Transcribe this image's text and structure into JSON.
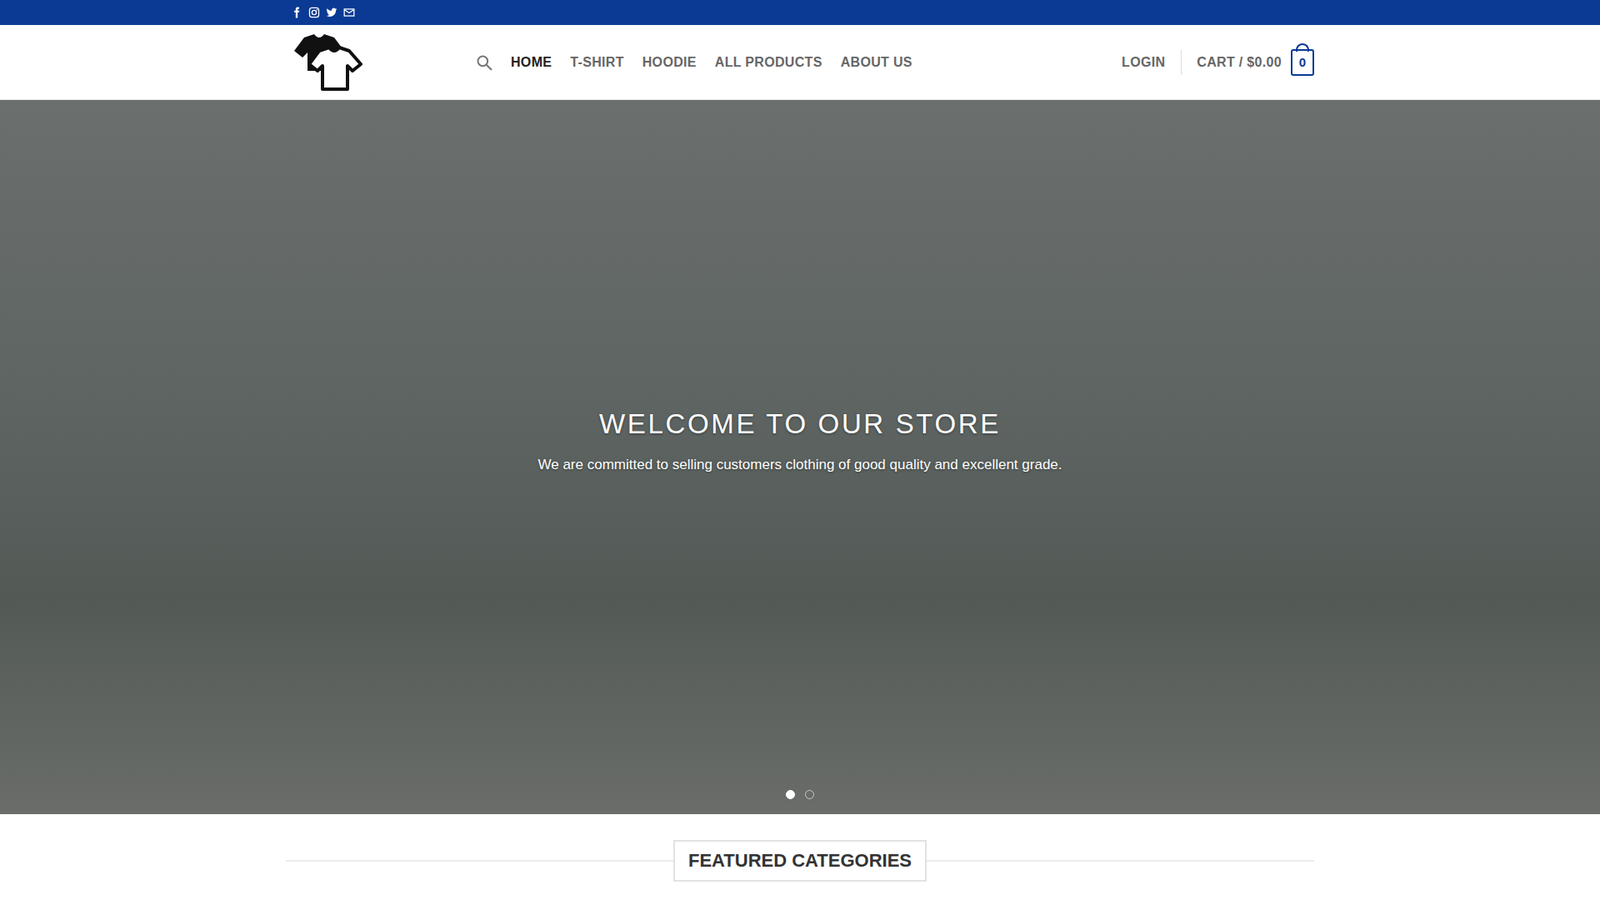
{
  "nav": [
    {
      "label": "HOME",
      "selected": true
    },
    {
      "label": "T-SHIRT",
      "selected": false
    },
    {
      "label": "HOODIE",
      "selected": false
    },
    {
      "label": "ALL PRODUCTS",
      "selected": false
    },
    {
      "label": "ABOUT US",
      "selected": false
    }
  ],
  "login": "LOGIN",
  "cart": {
    "label": "CART / $0.00",
    "count": "0"
  },
  "hero": {
    "title": "WELCOME TO OUR STORE",
    "subtitle": "We are committed to selling customers clothing of good quality and excellent grade.",
    "slides": [
      {
        "selected": true
      },
      {
        "selected": false
      }
    ]
  },
  "featured": {
    "title": "FEATURED CATEGORIES"
  }
}
